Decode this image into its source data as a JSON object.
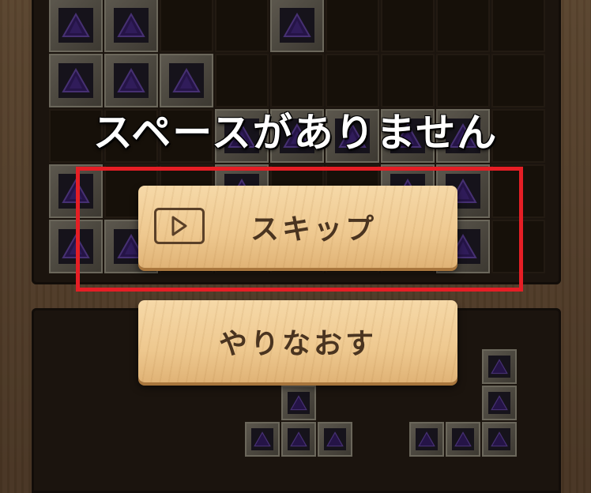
{
  "overlay": {
    "message": "スペースがありません"
  },
  "buttons": {
    "skip_label": "スキップ",
    "retry_label": "やりなおす"
  },
  "icons": {
    "skip_button_icon": "play-icon",
    "block_icon": "purple-gem-icon"
  },
  "colors": {
    "highlight_border": "#e51e25",
    "gem": "#3a1f6e",
    "button_wood": "#eec88f",
    "button_text": "#4a3420",
    "message_text": "#ffffff"
  },
  "board": {
    "rows": 5,
    "cols": 9,
    "filled": [
      [
        0,
        0
      ],
      [
        0,
        1
      ],
      [
        0,
        4
      ],
      [
        1,
        0
      ],
      [
        1,
        1
      ],
      [
        1,
        2
      ],
      [
        2,
        3
      ],
      [
        2,
        4
      ],
      [
        2,
        5
      ],
      [
        2,
        6
      ],
      [
        2,
        7
      ],
      [
        3,
        0
      ],
      [
        3,
        3
      ],
      [
        3,
        6
      ],
      [
        3,
        7
      ],
      [
        4,
        0
      ],
      [
        4,
        1
      ],
      [
        4,
        7
      ]
    ]
  },
  "tray_pieces": {
    "piece_a": [
      [
        0,
        1
      ],
      [
        1,
        0
      ],
      [
        1,
        1
      ],
      [
        1,
        2
      ]
    ],
    "piece_b": [
      [
        0,
        2
      ],
      [
        1,
        2
      ],
      [
        2,
        0
      ],
      [
        2,
        1
      ],
      [
        2,
        2
      ]
    ]
  }
}
